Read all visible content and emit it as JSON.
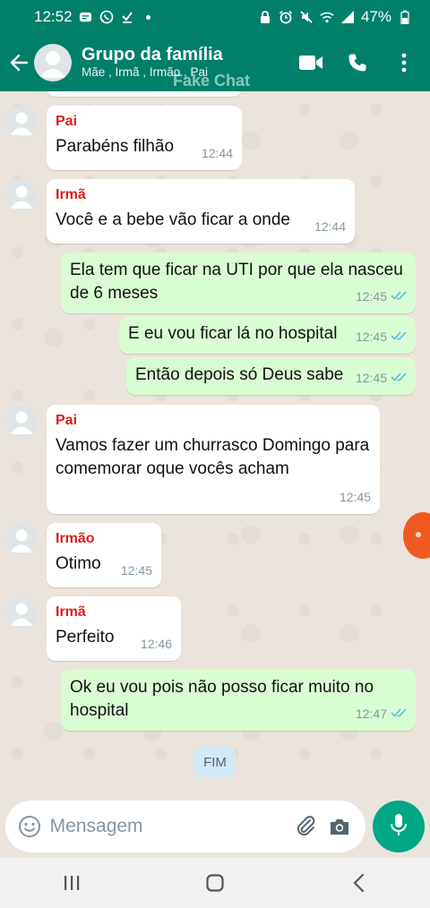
{
  "status_bar": {
    "time": "12:52",
    "battery": "47%"
  },
  "header": {
    "title": "Grupo da família",
    "subtitle": "Mãe , Irmã , Irmão , Pai",
    "watermark": "Fake Chat"
  },
  "messages": [
    {
      "dir": "in",
      "sender": "Pai",
      "text": "Parabéns filhão",
      "time": "12:44"
    },
    {
      "dir": "in",
      "sender": "Irmã",
      "text": "Você e a bebe vão ficar a onde",
      "time": "12:44"
    },
    {
      "dir": "out",
      "text": "Ela tem que ficar na UTI por que ela nasceu de 6 meses",
      "time": "12:45"
    },
    {
      "dir": "out",
      "text": "E eu vou ficar lá no hospital",
      "time": "12:45"
    },
    {
      "dir": "out",
      "text": "Então depois só Deus sabe",
      "time": "12:45"
    },
    {
      "dir": "in",
      "sender": "Pai",
      "text": "Vamos fazer um churrasco Domingo para comemorar oque vocês acham",
      "time": "12:45"
    },
    {
      "dir": "in",
      "sender": "Irmão",
      "text": "Otimo",
      "time": "12:45"
    },
    {
      "dir": "in",
      "sender": "Irmã",
      "text": "Perfeito",
      "time": "12:46"
    },
    {
      "dir": "out",
      "text": "Ok eu vou pois não posso ficar muito no hospital",
      "time": "12:47"
    }
  ],
  "system_label": "FIM",
  "input": {
    "placeholder": "Mensagem"
  },
  "colors": {
    "header": "#008069",
    "outgoing": "#d9fdd3",
    "incoming": "#ffffff",
    "sender": "#d81f1f",
    "read_ticks": "#53bdeb",
    "mic": "#00a884"
  },
  "icons": {
    "status_left": [
      "message-icon",
      "whatsapp-icon",
      "download-icon"
    ],
    "status_right": [
      "lock-icon",
      "alarm-icon",
      "mute-icon",
      "wifi-icon",
      "signal-icon",
      "battery-icon"
    ],
    "header": [
      "back-arrow-icon",
      "video-call-icon",
      "phone-icon",
      "more-vert-icon"
    ],
    "input": [
      "emoji-icon",
      "attach-icon",
      "camera-icon",
      "mic-icon"
    ]
  }
}
